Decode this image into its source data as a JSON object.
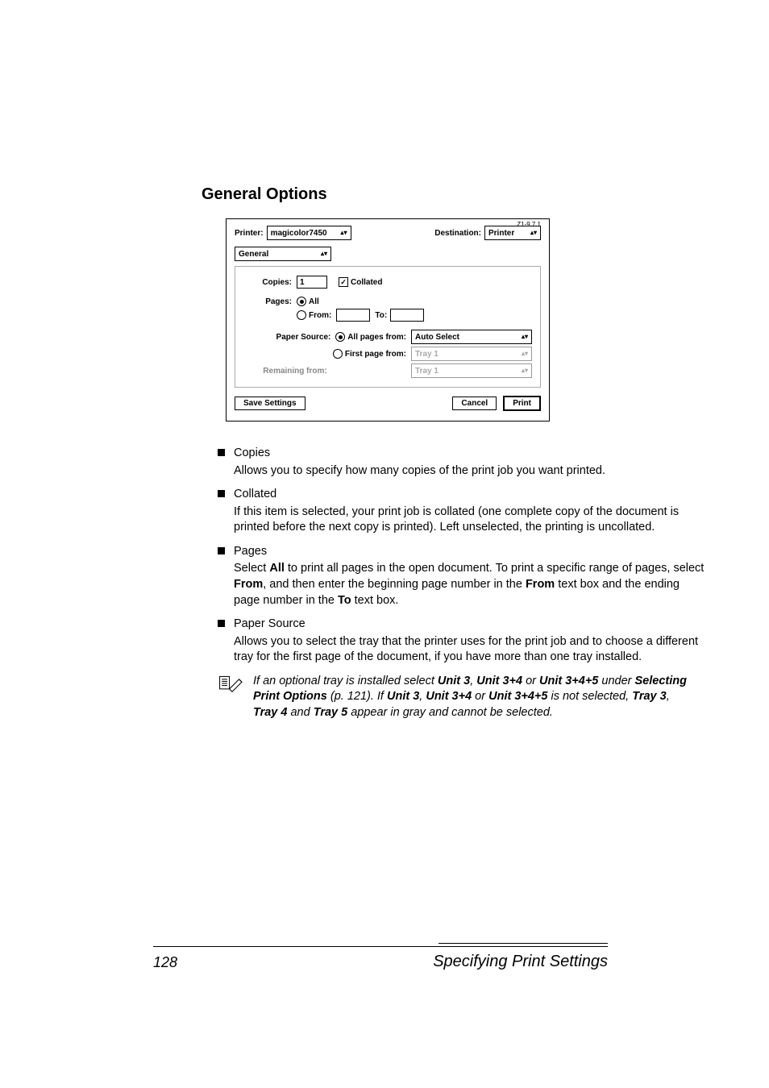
{
  "heading": "General Options",
  "dialog": {
    "version": "Z1-9.7.1",
    "printer_label": "Printer:",
    "printer_value": "magicolor7450",
    "destination_label": "Destination:",
    "destination_value": "Printer",
    "panel_value": "General",
    "copies_label": "Copies:",
    "copies_value": "1",
    "collated_label": "Collated",
    "collated_checked": "✓",
    "pages_label": "Pages:",
    "pages_all": "All",
    "pages_from_label": "From:",
    "pages_to_label": "To:",
    "paper_source_label": "Paper Source:",
    "ps_allpages": "All pages from:",
    "ps_allpages_value": "Auto Select",
    "ps_firstpage": "First page from:",
    "ps_firstpage_value": "Tray 1",
    "ps_remaining": "Remaining from:",
    "ps_remaining_value": "Tray 1",
    "save_settings": "Save Settings",
    "cancel": "Cancel",
    "print": "Print"
  },
  "bullets": {
    "copies": {
      "title": "Copies",
      "desc": "Allows you to specify how many copies of the print job you want printed."
    },
    "collated": {
      "title": "Collated",
      "desc": "If this item is selected, your print job is collated (one complete copy of the document is printed before the next copy is printed). Left unselected, the printing is uncollated."
    },
    "pages": {
      "title": "Pages",
      "p1a": "Select ",
      "p1b": "All",
      "p1c": " to print all pages in the open document. To print a specific range of pages, select ",
      "p1d": "From",
      "p1e": ", and then enter the beginning page number in the ",
      "p1f": "From",
      "p1g": " text box and the ending page number in the ",
      "p1h": "To",
      "p1i": " text box."
    },
    "paper_source": {
      "title": "Paper Source",
      "desc": "Allows you to select the tray that the printer uses for the print job and to choose a different tray for the first page of the document, if you have more than one tray installed."
    }
  },
  "note": {
    "a": "If an optional tray is installed select ",
    "u3": "Unit 3",
    "c1": ", ",
    "u34": "Unit 3+4",
    "or1": " or ",
    "u345": "Unit 3+4+5",
    "b": " under ",
    "sel": "Selecting Print Options",
    "c": " (p. 121). If ",
    "u3b": "Unit 3",
    "c2": ", ",
    "u34b": "Unit 3+4",
    "or2": " or ",
    "u345b": "Unit 3+4+5",
    "d": " is not selected, ",
    "t3": "Tray 3",
    "c3": ", ",
    "t4": "Tray 4",
    "and": " and ",
    "t5": "Tray 5",
    "e": " appear in gray and cannot be selected."
  },
  "footer": {
    "page": "128",
    "title": "Specifying Print Settings"
  }
}
